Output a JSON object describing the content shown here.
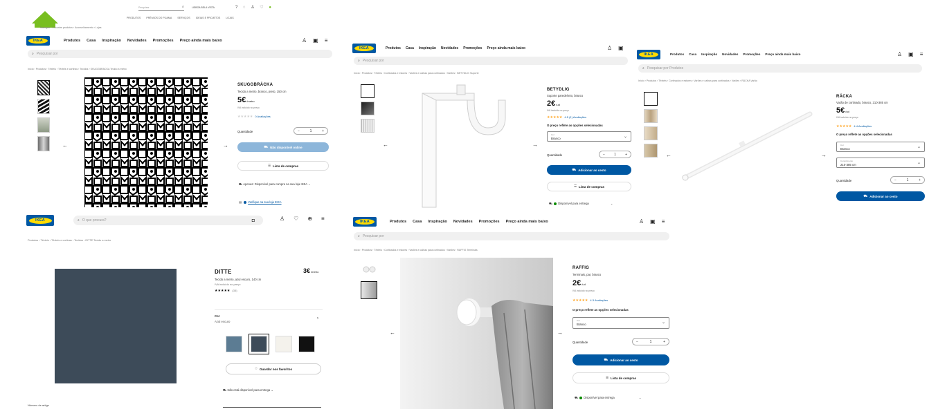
{
  "colors": {
    "ikea_blue": "#0058a3",
    "ikea_yellow": "#ffdb00",
    "star": "#ffa524",
    "leroy_green": "#78be20",
    "ditte_fabric": "#3d4b59"
  },
  "leroy": {
    "logo_text": "LEROY MERLIN",
    "search_placeholder": "Pesquisar",
    "store_text": "LISBOA BELA VISTA",
    "nav": [
      "PRODUTOS",
      "PRÉMIOS DO PIJAMA",
      "SERVIÇOS",
      "IDEIAS E PROJETOS",
      "LOJAS"
    ],
    "breadcrumb": "Navegue › Encontre produtos › Aconselhamento › Lojas"
  },
  "nav": {
    "logo": "IKEA",
    "items": [
      "Produtos",
      "Casa",
      "Inspiração",
      "Novidades",
      "Promoções",
      "Preço ainda mais baixo"
    ],
    "search_placeholder": "Pesquisar por",
    "icons": [
      "user-icon",
      "cart-icon",
      "menu-icon"
    ]
  },
  "p1": {
    "breadcrumb": "Início › Produtos › Têxteis › Têxteis e cortinas › Tecidos › SKUGGBRÄCKA Tecido a metro",
    "name": "SKUGGBRÄCKA",
    "desc": "Tecido a metro, branco, preto, 150 cm",
    "price": "5€",
    "unit": "/metro",
    "vat_note": "IVA incluído no preço",
    "reviews": "0 Avaliações",
    "qty_label": "Quantidade",
    "qty": "1",
    "cta": "Não disponível online",
    "list_btn": "Lista de compras",
    "stock": "Apenas: Disponível para compra na sua loja IKEA",
    "store_link": "Verifique na sua loja IKEA"
  },
  "p2": {
    "breadcrumb": "Início › Produtos › Têxteis › Cortinados e estores › Varões e calhas para cortinados › Varões › BETYDLIG Suporte",
    "name": "BETYDLIG",
    "desc": "Suporte parede/teto, branco",
    "price": "2€",
    "unit": "/ud",
    "vat_note": "IVA incluído no preço",
    "reviews": "4.5 (1) Avaliações",
    "options_note": "O preço reflete as opções selecionadas",
    "color_caption": "Cor",
    "color_value": "Branco",
    "qty_label": "Quantidade",
    "qty": "1",
    "cta": "Adicionar ao cesto",
    "list_btn": "Lista de compras",
    "delivery": "Disponível para entrega"
  },
  "p3": {
    "search_placeholder": "Pesquisar por Produtos",
    "breadcrumb": "Início › Produtos › Têxteis › Cortinados e estores › Varões e calhas para cortinados › Varões › RÄCKA Varão",
    "name": "RÄCKA",
    "desc": "Varão de cortinado, branco, 210-385 cm",
    "price": "5€",
    "unit": "/ud",
    "vat_note": "IVA incluído no preço",
    "reviews": "4.4 Avaliações",
    "options_note": "O preço reflete as opções selecionadas",
    "color_caption": "Cor",
    "color_value": "Branco",
    "size_caption": "Comprimento",
    "size_value": "210-385 cm",
    "qty_label": "Quantidade",
    "qty": "1",
    "cta": "Adicionar ao cesto"
  },
  "p4": {
    "search_placeholder": "O que procura?",
    "breadcrumb": "Produtos › Têxteis › Têxteis e cortinas › Tecidos › DITTE Tecido a metro",
    "name": "DITTE",
    "price": "3€",
    "unit": "/metro",
    "desc": "Tecido a metro, azul escuro, 140 cm",
    "vat_note": "IVA incluído no preço",
    "reviews": "(33)",
    "color_label": "Cor",
    "color_value": "Azul escuro",
    "fav_btn": "Guardar nos favoritos",
    "delivery": "Não está disponível para entrega",
    "article": "Número de artigo"
  },
  "p5": {
    "breadcrumb": "Início › Produtos › Têxteis › Cortinados e estores › Varões e calhas para cortinados › Varões › RAFFIG Terminais",
    "name": "RAFFIG",
    "desc": "Terminais, par, branco",
    "price": "2€",
    "unit": "/ud",
    "vat_note": "IVA incluído no preço",
    "reviews": "4.3 Avaliações",
    "options_note": "O preço reflete as opções selecionadas",
    "color_caption": "Cor",
    "color_value": "Branco",
    "qty_label": "Quantidade",
    "qty": "1",
    "cta": "Adicionar ao cesto",
    "list_btn": "Lista de compras",
    "delivery": "Disponível para entrega"
  }
}
